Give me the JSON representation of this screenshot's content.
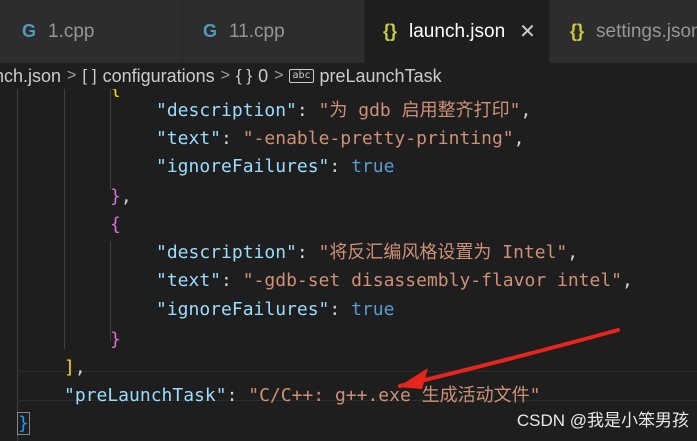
{
  "tabs": [
    {
      "label": "1.cpp",
      "icon": "C++"
    },
    {
      "label": "11.cpp",
      "icon": "C++"
    },
    {
      "label": "launch.json",
      "icon": "{}",
      "close": "✕"
    },
    {
      "label": "settings.json",
      "icon": "{}"
    }
  ],
  "breadcrumb": {
    "file": "nch.json",
    "configurations": "configurations",
    "index": "0",
    "task": "preLaunchTask"
  },
  "code": {
    "l1_key": "\"description\"",
    "l1_val": "\"为 gdb 启用整齐打印\"",
    "l2_key": "\"text\"",
    "l2_val": "\"-enable-pretty-printing\"",
    "l3_key": "\"ignoreFailures\"",
    "l3_val": "true",
    "l4": "}",
    "l4_comma": ",",
    "l5": "{",
    "l6_key": "\"description\"",
    "l6_val": "\"将反汇编风格设置为 Intel\"",
    "l7_key": "\"text\"",
    "l7_val": "\"-gdb-set disassembly-flavor intel\"",
    "l8_key": "\"ignoreFailures\"",
    "l8_val": "true",
    "l9": "}",
    "l10": "]",
    "l10_comma": ",",
    "l11_key": "\"preLaunchTask\"",
    "l11_val": "\"C/C++: g++.exe 生成活动文件\"",
    "l12": "}"
  },
  "watermark": "CSDN @我是小笨男孩",
  "colors": {
    "key": "#9cdcfe",
    "string": "#ce9178",
    "bool": "#569cd6",
    "arrow": "#e8251c"
  }
}
